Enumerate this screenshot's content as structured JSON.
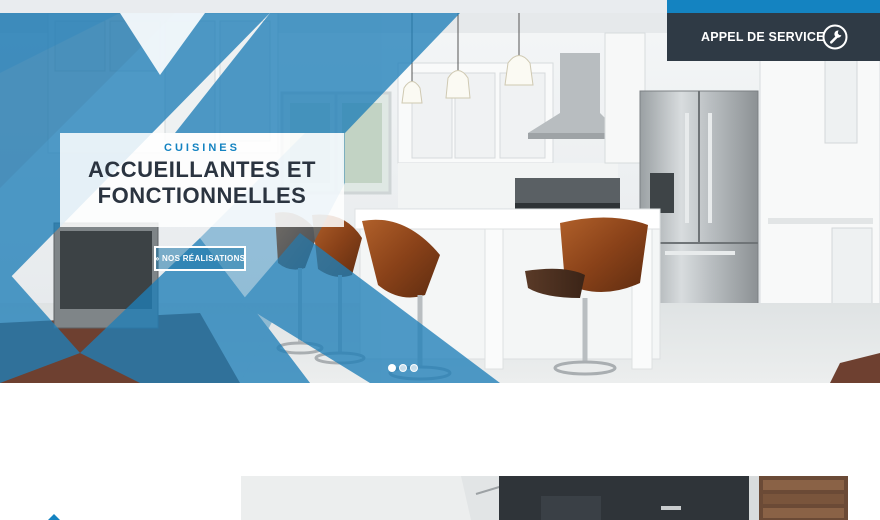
{
  "service": {
    "label": "APPEL DE SERVICE",
    "icon": "wrench-icon",
    "accent_color": "#1483c1",
    "bg_color": "#2f3a45"
  },
  "hero": {
    "eyebrow": "CUISINES",
    "headline_line1": "ACCUEILLANTES ET",
    "headline_line2": "FONCTIONNELLES",
    "button_label": "» NOS RÉALISATIONS",
    "overlay_color": "#1f7fb8",
    "slides_total": 3,
    "active_slide": 1
  },
  "colors": {
    "brand_blue": "#1483c1",
    "dark": "#2b3440"
  }
}
